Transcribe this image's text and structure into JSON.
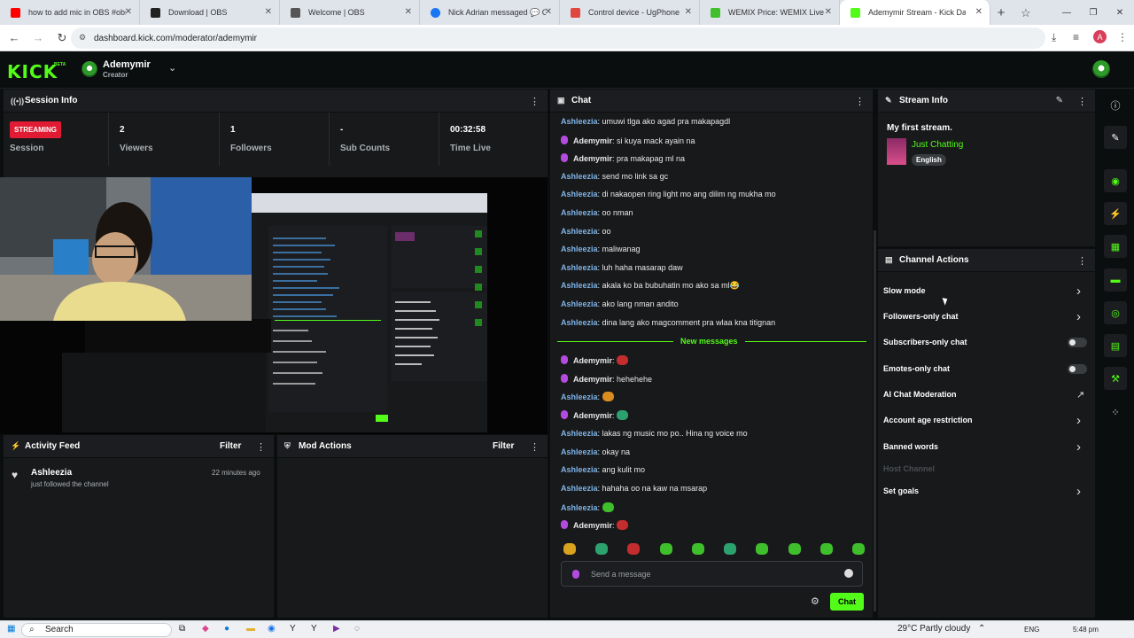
{
  "browser": {
    "tabs": [
      {
        "label": "how to add mic in OBS #obs #s",
        "color": "#ff0000"
      },
      {
        "label": "Download | OBS",
        "color": "#222222"
      },
      {
        "label": "Welcome | OBS",
        "color": "#555555"
      },
      {
        "label": "Nick Adrian messaged 💬 Cou",
        "color": "#1877f2"
      },
      {
        "label": "Control device - UgPhone",
        "color": "#e0473f"
      },
      {
        "label": "WEMIX Price: WEMIX Live Price",
        "color": "#3fbf2c"
      },
      {
        "label": "Ademymir Stream - Kick Da",
        "color": "#53fc18"
      }
    ],
    "url": "dashboard.kick.com/moderator/ademymir",
    "profile_initial": "A"
  },
  "header": {
    "logo": "KICK",
    "beta": "BETA",
    "username": "Ademymir",
    "role": "Creator"
  },
  "session": {
    "title": "Session Info",
    "live_badge": "STREAMING",
    "live_label": "Session",
    "stats": [
      {
        "value": "2",
        "label": "Viewers"
      },
      {
        "value": "1",
        "label": "Followers"
      },
      {
        "value": "-",
        "label": "Sub Counts"
      },
      {
        "value": "00:32:58",
        "label": "Time Live"
      }
    ]
  },
  "activity": {
    "title": "Activity Feed",
    "filter": "Filter",
    "items": [
      {
        "user": "Ashleezia",
        "action": "just followed the channel",
        "time": "22 minutes ago"
      }
    ]
  },
  "mod_actions": {
    "title": "Mod Actions",
    "filter": "Filter"
  },
  "chat": {
    "title": "Chat",
    "messages_before": [
      {
        "user": "Ashleezia",
        "mod": false,
        "text": ": umuwi tlga ako agad pra makapagdl"
      },
      {
        "user": "Ademymir",
        "mod": true,
        "text": ": si kuya mack ayain na"
      },
      {
        "user": "Ademymir",
        "mod": true,
        "text": ": pra makapag ml na"
      },
      {
        "user": "Ashleezia",
        "mod": false,
        "text": ": send mo link sa gc"
      },
      {
        "user": "Ashleezia",
        "mod": false,
        "text": ": di nakaopen ring light mo ang dilim ng mukha mo"
      },
      {
        "user": "Ashleezia",
        "mod": false,
        "text": ": oo nman"
      },
      {
        "user": "Ashleezia",
        "mod": false,
        "text": ": oo"
      },
      {
        "user": "Ashleezia",
        "mod": false,
        "text": ": maliwanag"
      },
      {
        "user": "Ashleezia",
        "mod": false,
        "text": ": luh haha masarap daw"
      },
      {
        "user": "Ashleezia",
        "mod": false,
        "text": ": akala ko ba bubuhatin mo ako sa ml😂"
      },
      {
        "user": "Ashleezia",
        "mod": false,
        "text": ": ako lang nman andito"
      },
      {
        "user": "Ashleezia",
        "mod": false,
        "text": ": dina lang ako magcomment pra wlaa kna titignan"
      }
    ],
    "new_messages_label": "New messages",
    "messages_after": [
      {
        "user": "Ademymir",
        "mod": true,
        "text": ":",
        "emote": "red"
      },
      {
        "user": "Ademymir",
        "mod": true,
        "text": ": hehehehe"
      },
      {
        "user": "Ashleezia",
        "mod": false,
        "text": ":",
        "emote": "orange"
      },
      {
        "user": "Ademymir",
        "mod": true,
        "text": ":",
        "emote": "teal"
      },
      {
        "user": "Ashleezia",
        "mod": false,
        "text": ": lakas ng music mo po.. Hina ng voice mo"
      },
      {
        "user": "Ashleezia",
        "mod": false,
        "text": ": okay na"
      },
      {
        "user": "Ashleezia",
        "mod": false,
        "text": ": ang kulit mo"
      },
      {
        "user": "Ashleezia",
        "mod": false,
        "text": ": hahaha oo na kaw na msarap"
      },
      {
        "user": "Ashleezia",
        "mod": false,
        "text": ":",
        "emote": "green"
      },
      {
        "user": "Ademymir",
        "mod": true,
        "text": ":",
        "emote": "red"
      }
    ],
    "input_placeholder": "Send a message",
    "send_label": "Chat"
  },
  "stream_info": {
    "title": "Stream Info",
    "stream_title": "My first stream.",
    "category": "Just Chatting",
    "language": "English"
  },
  "channel_actions": {
    "title": "Channel Actions",
    "items": [
      {
        "label": "Slow mode",
        "control": "chevron"
      },
      {
        "label": "Followers-only chat",
        "control": "chevron"
      },
      {
        "label": "Subscribers-only chat",
        "control": "toggle"
      },
      {
        "label": "Emotes-only chat",
        "control": "toggle"
      },
      {
        "label": "AI Chat Moderation",
        "control": "external"
      },
      {
        "label": "Account age restriction",
        "control": "chevron"
      },
      {
        "label": "Banned words",
        "control": "chevron"
      },
      {
        "label": "Host Channel",
        "control": "disabled"
      },
      {
        "label": "Set goals",
        "control": "chevron"
      }
    ]
  },
  "taskbar": {
    "search": "Search",
    "weather": "29°C  Partly cloudy",
    "lang": "ENG",
    "time": "5:48 pm"
  },
  "colors": {
    "brand": "#53fc18",
    "live": "#e01b33",
    "username": "#7fb3e6"
  }
}
